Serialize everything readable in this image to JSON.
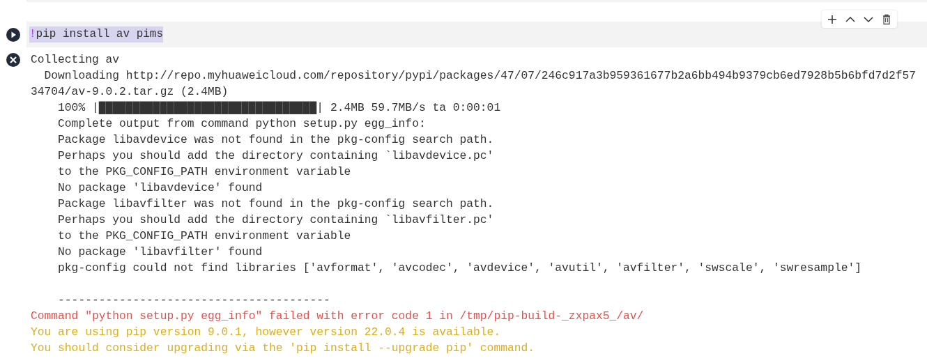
{
  "cell_toolbar": [
    {
      "kind": "add"
    },
    {
      "kind": "up"
    },
    {
      "kind": "down"
    },
    {
      "kind": "delete"
    }
  ],
  "code_cell": {
    "bang": "!",
    "code": "pip install av pims",
    "selected": true
  },
  "output": {
    "failed": true,
    "lines": [
      {
        "kind": "normal",
        "text": "Collecting av"
      },
      {
        "kind": "normal",
        "text": "  Downloading http://repo.myhuaweicloud.com/repository/pypi/packages/47/07/246c917a3b959361677b2a6bb494b9379cb6ed7928b5b6bfd7d2f57"
      },
      {
        "kind": "normal",
        "text": "34704/av-9.0.2.tar.gz (2.4MB)"
      },
      {
        "kind": "normal",
        "text": "    100% |████████████████████████████████| 2.4MB 59.7MB/s ta 0:00:01"
      },
      {
        "kind": "normal",
        "text": "    Complete output from command python setup.py egg_info:"
      },
      {
        "kind": "normal",
        "text": "    Package libavdevice was not found in the pkg-config search path."
      },
      {
        "kind": "normal",
        "text": "    Perhaps you should add the directory containing `libavdevice.pc'"
      },
      {
        "kind": "normal",
        "text": "    to the PKG_CONFIG_PATH environment variable"
      },
      {
        "kind": "normal",
        "text": "    No package 'libavdevice' found"
      },
      {
        "kind": "normal",
        "text": "    Package libavfilter was not found in the pkg-config search path."
      },
      {
        "kind": "normal",
        "text": "    Perhaps you should add the directory containing `libavfilter.pc'"
      },
      {
        "kind": "normal",
        "text": "    to the PKG_CONFIG_PATH environment variable"
      },
      {
        "kind": "normal",
        "text": "    No package 'libavfilter' found"
      },
      {
        "kind": "normal",
        "text": "    pkg-config could not find libraries ['avformat', 'avcodec', 'avdevice', 'avutil', 'avfilter', 'swscale', 'swresample']"
      },
      {
        "kind": "blank"
      },
      {
        "kind": "normal",
        "text": "    ----------------------------------------"
      },
      {
        "kind": "error",
        "text": "Command \"python setup.py egg_info\" failed with error code 1 in /tmp/pip-build-_zxpax5_/av/"
      },
      {
        "kind": "warning",
        "text": "You are using pip version 9.0.1, however version 22.0.4 is available."
      },
      {
        "kind": "warning",
        "text": "You should consider upgrading via the 'pip install --upgrade pip' command."
      }
    ]
  }
}
